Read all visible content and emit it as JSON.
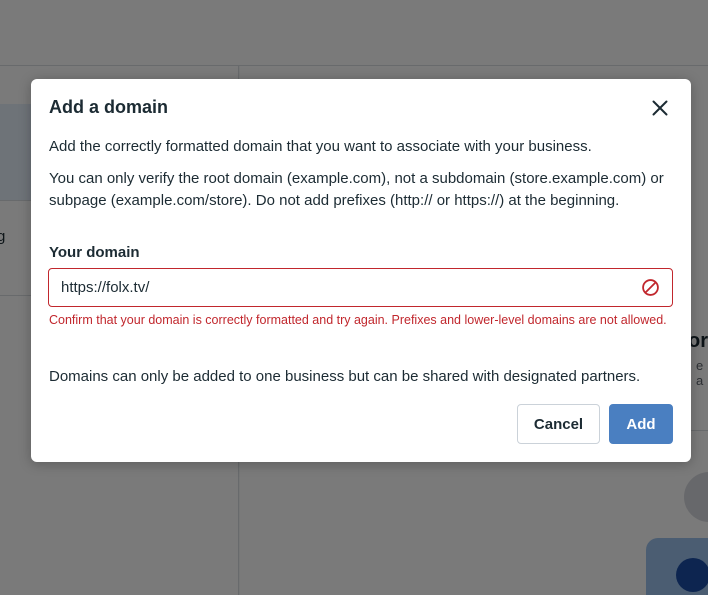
{
  "background": {
    "left_glyph": "g",
    "right_heading": "or",
    "right_subtext": "e a"
  },
  "dialog": {
    "title": "Add a domain",
    "close_label": "Close",
    "intro": "Add the correctly formatted domain that you want to associate with your business.",
    "instructions": "You can only verify the root domain (example.com), not a subdomain (store.example.com) or subpage (example.com/store). Do not add prefixes (http:// or https://) at the beginning.",
    "field_label": "Your domain",
    "domain_value": "https://folx.tv/",
    "error_message": "Confirm that your domain is correctly formatted and try again. Prefixes and lower-level domains are not allowed.",
    "footer_note": "Domains can only be added to one business but can be shared with designated partners.",
    "cancel_label": "Cancel",
    "add_label": "Add"
  },
  "colors": {
    "primary": "#4a7fc1",
    "error": "#c1272d",
    "text": "#1c2b33"
  },
  "icons": {
    "close": "close-icon",
    "error": "error-prohibited-icon"
  }
}
